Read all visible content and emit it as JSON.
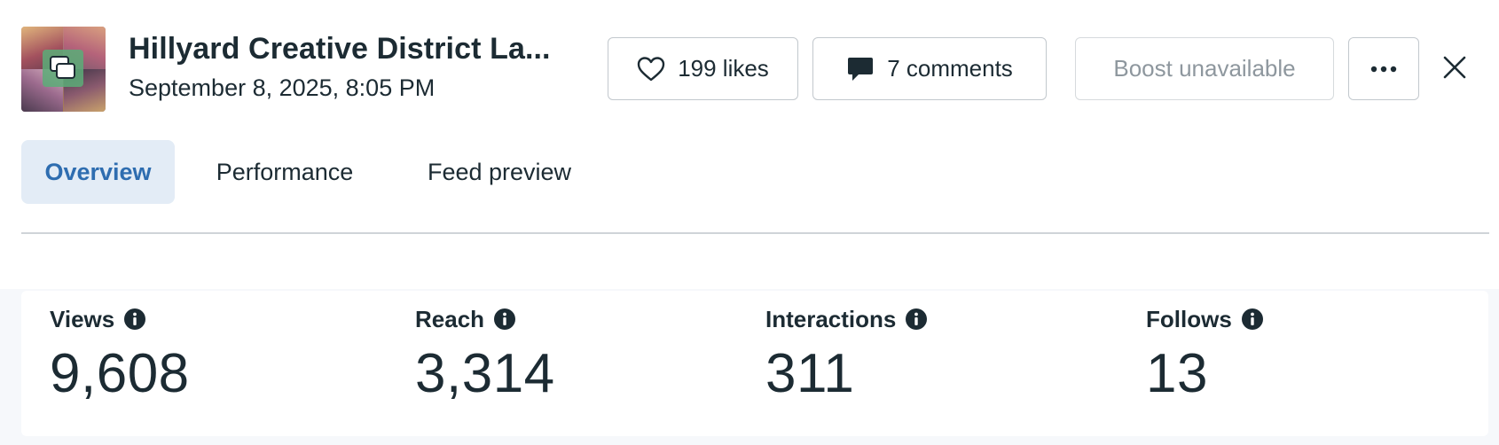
{
  "header": {
    "post_title": "Hillyard Creative District La...",
    "post_date": "September 8, 2025, 8:05 PM",
    "thumbnail_icon": "gallery-icon",
    "likes_label": "199 likes",
    "comments_label": "7 comments",
    "boost_label": "Boost unavailable",
    "more_icon": "more-horizontal-icon",
    "close_icon": "close-icon"
  },
  "tabs": [
    {
      "label": "Overview",
      "active": true
    },
    {
      "label": "Performance",
      "active": false
    },
    {
      "label": "Feed preview",
      "active": false
    }
  ],
  "metrics": [
    {
      "label": "Views",
      "value": "9,608"
    },
    {
      "label": "Reach",
      "value": "3,314"
    },
    {
      "label": "Interactions",
      "value": "311"
    },
    {
      "label": "Follows",
      "value": "13"
    }
  ],
  "colors": {
    "text": "#1c2b33",
    "active_tab_bg": "#e3ecf6",
    "active_tab_text": "#2e6db0",
    "disabled_text": "#8e979e"
  }
}
